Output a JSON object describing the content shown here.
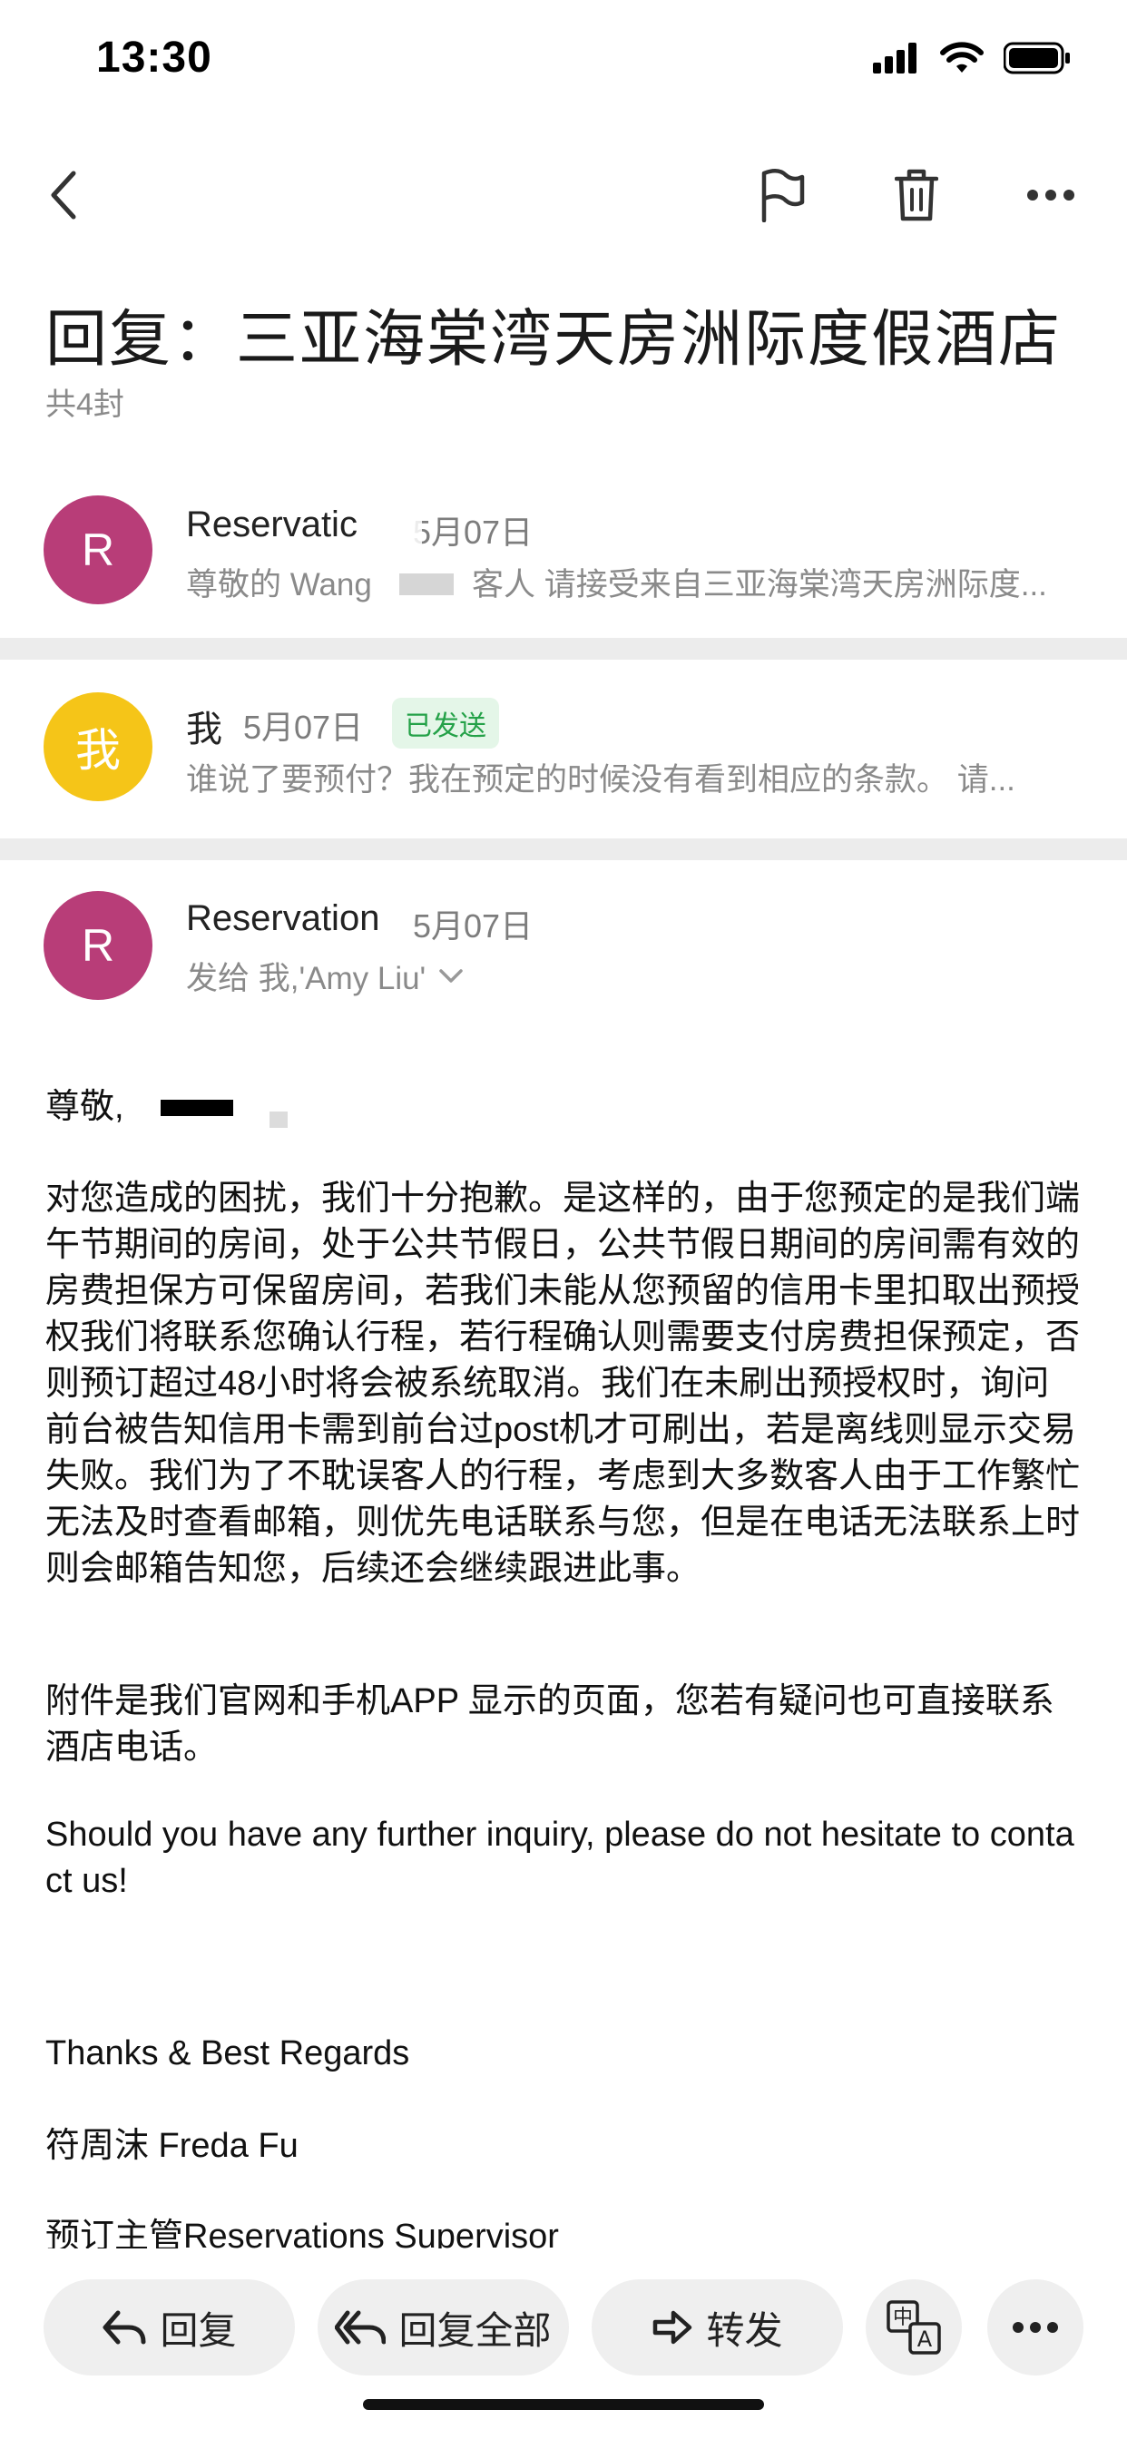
{
  "status_bar": {
    "time": "13:30"
  },
  "header": {
    "subject": "回复：三亚海棠湾天房洲际度假酒店",
    "count": "共4封"
  },
  "thread": [
    {
      "avatar": "R",
      "avatar_color": "#b83d78",
      "sender": "Reservatic",
      "date": "5月07日",
      "preview": "尊敬的 Wang",
      "preview_rest": "客人 请接受来自三亚海棠湾天房洲际度..."
    },
    {
      "avatar": "我",
      "avatar_color": "#f5c518",
      "sender": "我",
      "date": "5月07日",
      "badge": "已发送",
      "preview": "谁说了要预付？我在预定的时候没有看到相应的条款。 请..."
    },
    {
      "avatar": "R",
      "avatar_color": "#b83d78",
      "sender": "Reservation",
      "date": "5月07日",
      "to": "发给 我,'Amy Liu'"
    }
  ],
  "message": {
    "greeting": "尊敬,",
    "para1": "对您造成的困扰，我们十分抱歉。是这样的，由于您预定的是我们端午节期间的房间，处于公共节假日，公共节假日期间的房间需有效的房费担保方可保留房间，若我们未能从您预留的信用卡里扣取出预授权我们将联系您确认行程，若行程确认则需要支付房费担保预定，否则预订超过48小时将会被系统取消。我们在未刷出预授权时，询问前台被告知信用卡需到前台过post机才可刷出，若是离线则显示交易失败。我们为了不耽误客人的行程，考虑到大多数客人由于工作繁忙无法及时查看邮箱，则优先电话联系与您，但是在电话无法联系上时则会邮箱告知您，后续还会继续跟进此事。",
    "para2": "附件是我们官网和手机APP 显示的页面，您若有疑问也可直接联系酒店电话。",
    "para3": "Should you have any further inquiry, please do not hesitate  to contact us!",
    "closing": "Thanks & Best Regards",
    "signature": "符周沫 Freda Fu",
    "title": "预订主管Reservations Supervisor"
  },
  "bottom_bar": {
    "reply": "回复",
    "reply_all": "回复全部",
    "forward": "转发"
  },
  "icons": [
    "back-icon",
    "flag-icon",
    "trash-icon",
    "more-icon",
    "chevron-down-icon",
    "reply-icon",
    "reply-all-icon",
    "forward-icon",
    "translate-icon"
  ]
}
